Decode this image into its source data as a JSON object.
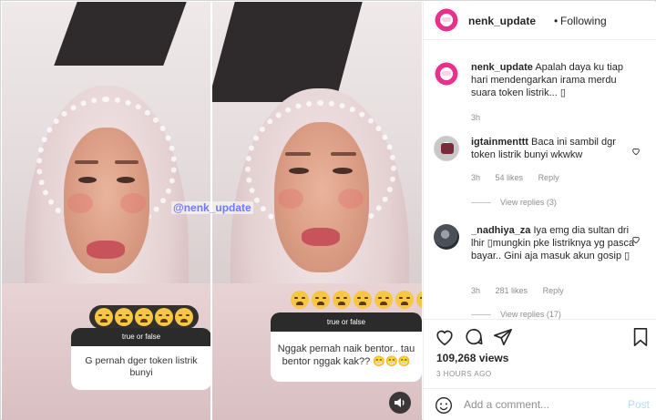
{
  "post": {
    "watermark": "@nenk_update",
    "story1": {
      "question_header": "true or false",
      "question_text": "G pernah dger token listrik bunyi"
    },
    "story2": {
      "question_header": "true or false",
      "question_text": "Nggak pernah naik bentor.. tau bentor nggak kak?? 😁😁😁"
    }
  },
  "header": {
    "username": "nenk_update",
    "separator": "•",
    "follow_status": "Following"
  },
  "caption": {
    "username": "nenk_update",
    "text": "Apalah daya ku tiap hari mendengarkan irama merdu suara token listrik... ▯",
    "time": "3h"
  },
  "comments": [
    {
      "username": "igtainmenttt",
      "text": "Baca ini sambil dgr token listrik bunyi wkwkw",
      "time": "3h",
      "likes": "54 likes",
      "reply": "Reply",
      "view_replies": "View replies (3)"
    },
    {
      "username": "_nadhiya_za",
      "text": "Iya emg dia sultan dri lhir ▯mungkin pke listriknya yg pasca bayar.. Gini aja masuk akun gosip ▯",
      "time": "3h",
      "likes": "281 likes",
      "reply": "Reply",
      "view_replies": "View replies (17)"
    }
  ],
  "stats": {
    "views": "109,268 views",
    "time_ago": "3 HOURS AGO"
  },
  "add_comment": {
    "placeholder": "Add a comment...",
    "post_label": "Post"
  },
  "icons": {
    "like": "heart-icon",
    "comment": "comment-icon",
    "share": "share-icon",
    "save": "bookmark-icon",
    "emoji": "smiley-icon",
    "sound": "speaker-icon"
  },
  "colors": {
    "text": "#262626",
    "muted": "#8e8e8e",
    "post_disabled": "#b2dffc",
    "watermark": "#6f79ff"
  }
}
